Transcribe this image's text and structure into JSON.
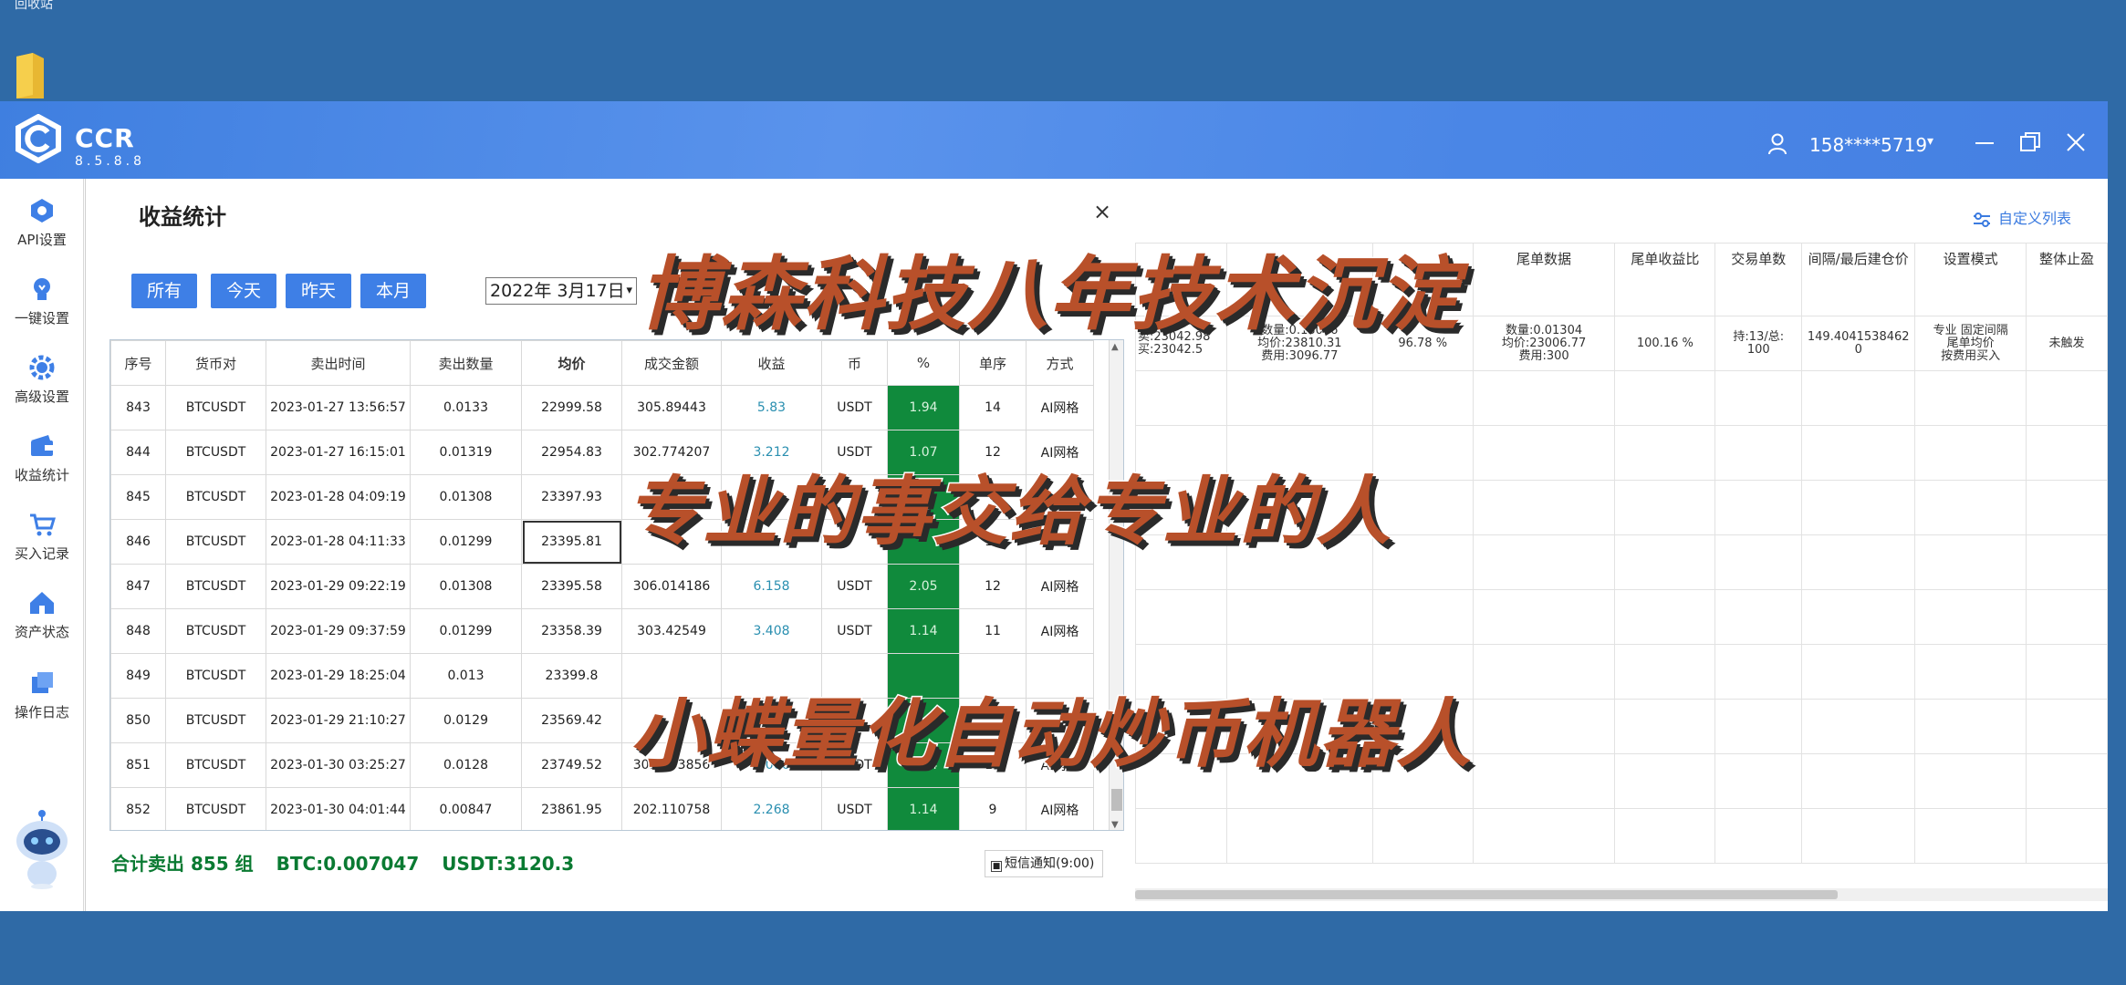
{
  "desktop": {
    "label": "回收站"
  },
  "app": {
    "name": "CCR",
    "version": "8.5.8.8",
    "user": "158****5719",
    "caret": "▾"
  },
  "sidebar": {
    "items": [
      {
        "label": "API设置",
        "icon": "api-settings-icon"
      },
      {
        "label": "一键设置",
        "icon": "bulb-icon"
      },
      {
        "label": "高级设置",
        "icon": "gear-icon"
      },
      {
        "label": "收益统计",
        "icon": "wallet-icon"
      },
      {
        "label": "买入记录",
        "icon": "cart-icon"
      },
      {
        "label": "资产状态",
        "icon": "home-icon"
      },
      {
        "label": "操作日志",
        "icon": "log-icon"
      }
    ]
  },
  "background": {
    "custom_columns": "自定义列表",
    "headers": [
      "",
      "",
      "",
      "尾单数据",
      "尾单收益比",
      "交易单数",
      "间隔/最后建仓价",
      "设置模式",
      "整体止盈"
    ],
    "row": [
      "卖:23042.98\n买:23042.5",
      "数量:0.13006\n均价:23810.31\n费用:3096.77",
      "96.78 %",
      "数量:0.01304\n均价:23006.77\n费用:300",
      "100.16 %",
      "持:13/总:\n100",
      "149.4041538462\n0",
      "专业 固定间隔\n尾单均价\n按费用买入",
      "未触发"
    ]
  },
  "dialog": {
    "title": "收益统计",
    "close": "×",
    "quick_buttons": [
      "所有",
      "今天",
      "昨天",
      "本月"
    ],
    "date": "2022年 3月17日",
    "date_caret": "▾",
    "columns": [
      "序号",
      "货币对",
      "卖出时间",
      "卖出数量",
      "均价",
      "成交金额",
      "收益",
      "币",
      "%",
      "单序",
      "方式"
    ],
    "rows": [
      [
        "843",
        "BTCUSDT",
        "2023-01-27 13:56:57",
        "0.0133",
        "22999.58",
        "305.89443",
        "5.83",
        "USDT",
        "1.94",
        "14",
        "AI网格"
      ],
      [
        "844",
        "BTCUSDT",
        "2023-01-27 16:15:01",
        "0.01319",
        "22954.83",
        "302.774207",
        "3.212",
        "USDT",
        "1.07",
        "12",
        "AI网格"
      ],
      [
        "845",
        "BTCUSDT",
        "2023-01-28 04:09:19",
        "0.01308",
        "23397.93",
        "",
        "",
        "",
        "",
        "",
        ""
      ],
      [
        "846",
        "BTCUSDT",
        "2023-01-28 04:11:33",
        "0.01299",
        "23395.81",
        "",
        "",
        "",
        "",
        "11",
        ""
      ],
      [
        "847",
        "BTCUSDT",
        "2023-01-29 09:22:19",
        "0.01308",
        "23395.58",
        "306.014186",
        "6.158",
        "USDT",
        "2.05",
        "12",
        "AI网格"
      ],
      [
        "848",
        "BTCUSDT",
        "2023-01-29 09:37:59",
        "0.01299",
        "23358.39",
        "303.42549",
        "3.408",
        "USDT",
        "1.14",
        "11",
        "AI网格"
      ],
      [
        "849",
        "BTCUSDT",
        "2023-01-29 18:25:04",
        "0.013",
        "23399.8",
        "",
        "",
        "",
        "",
        "",
        ""
      ],
      [
        "850",
        "BTCUSDT",
        "2023-01-29 21:10:27",
        "0.0129",
        "23569.42",
        "",
        "",
        "",
        "",
        "",
        ""
      ],
      [
        "851",
        "BTCUSDT",
        "2023-01-30 03:25:27",
        "0.0128",
        "23749.52",
        "303.993856",
        "4.006",
        "USDT",
        "1.34",
        "10",
        "AI网格"
      ],
      [
        "852",
        "BTCUSDT",
        "2023-01-30 04:01:44",
        "0.00847",
        "23861.95",
        "202.110758",
        "2.268",
        "USDT",
        "1.14",
        "9",
        "AI网格"
      ]
    ],
    "summary": {
      "total": "合计卖出 855 组",
      "btc": "BTC:0.007047",
      "usdt": "USDT:3120.3"
    },
    "sms_label": "短信通知(9:00)"
  },
  "overlay": {
    "line1": "博森科技八年技术沉淀",
    "line2": "专业的事交给专业的人",
    "line3": "小蝶量化自动炒币机器人"
  }
}
